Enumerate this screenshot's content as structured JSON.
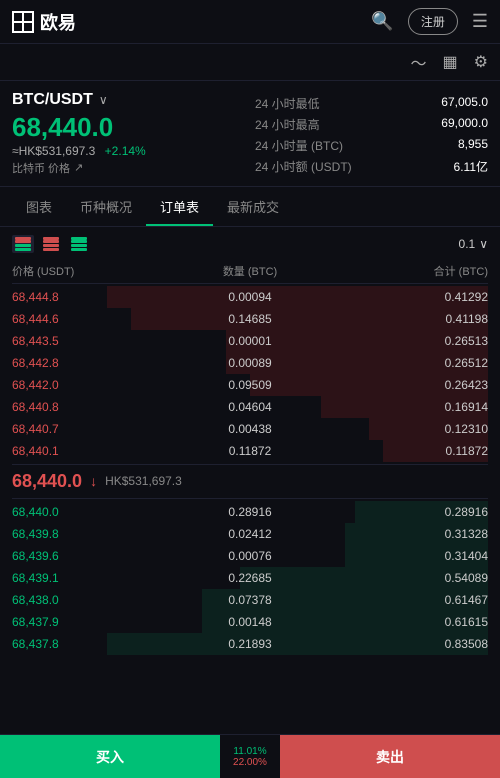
{
  "header": {
    "logo_text": "欧易",
    "register_label": "注册",
    "menu_icon": "☰"
  },
  "subheader": {
    "chart_icon": "📈",
    "list_icon": "📋",
    "settings_icon": "⚙"
  },
  "market": {
    "pair": "BTC/USDT",
    "price": "68,440.0",
    "hkd_approx": "≈HK$531,697.3",
    "change": "+2.14%",
    "coin_label": "比特币 价格",
    "stat1_label": "24 小时最低",
    "stat1_value": "67,005.0",
    "stat2_label": "24 小时最高",
    "stat2_value": "69,000.0",
    "stat3_label": "24 小时量 (BTC)",
    "stat3_value": "8,955",
    "stat4_label": "24 小时额 (USDT)",
    "stat4_value": "6.11亿"
  },
  "tabs": [
    {
      "label": "图表",
      "active": false
    },
    {
      "label": "币种概况",
      "active": false
    },
    {
      "label": "订单表",
      "active": true
    },
    {
      "label": "最新成交",
      "active": false
    }
  ],
  "orderbook": {
    "precision": "0.1",
    "col_price": "价格 (USDT)",
    "col_qty": "数量 (BTC)",
    "col_total": "合计 (BTC)",
    "sell_orders": [
      {
        "price": "68,444.8",
        "qty": "0.00094",
        "total": "0.41292",
        "bar_pct": 80
      },
      {
        "price": "68,444.6",
        "qty": "0.14685",
        "total": "0.41198",
        "bar_pct": 75
      },
      {
        "price": "68,443.5",
        "qty": "0.00001",
        "total": "0.26513",
        "bar_pct": 55
      },
      {
        "price": "68,442.8",
        "qty": "0.00089",
        "total": "0.26512",
        "bar_pct": 55
      },
      {
        "price": "68,442.0",
        "qty": "0.09509",
        "total": "0.26423",
        "bar_pct": 50
      },
      {
        "price": "68,440.8",
        "qty": "0.04604",
        "total": "0.16914",
        "bar_pct": 35
      },
      {
        "price": "68,440.7",
        "qty": "0.00438",
        "total": "0.12310",
        "bar_pct": 25
      },
      {
        "price": "68,440.1",
        "qty": "0.11872",
        "total": "0.11872",
        "bar_pct": 22
      }
    ],
    "mid_price": "68,440.0",
    "mid_hkd": "HK$531,697.3",
    "buy_orders": [
      {
        "price": "68,440.0",
        "qty": "0.28916",
        "total": "0.28916",
        "bar_pct": 28
      },
      {
        "price": "68,439.8",
        "qty": "0.02412",
        "total": "0.31328",
        "bar_pct": 30
      },
      {
        "price": "68,439.6",
        "qty": "0.00076",
        "total": "0.31404",
        "bar_pct": 30
      },
      {
        "price": "68,439.1",
        "qty": "0.22685",
        "total": "0.54089",
        "bar_pct": 52
      },
      {
        "price": "68,438.0",
        "qty": "0.07378",
        "total": "0.61467",
        "bar_pct": 60
      },
      {
        "price": "68,437.9",
        "qty": "0.00148",
        "total": "0.61615",
        "bar_pct": 60
      },
      {
        "price": "68,437.8",
        "qty": "0.21893",
        "total": "0.83508",
        "bar_pct": 80
      }
    ]
  },
  "bottom": {
    "buy_label": "买入",
    "sell_label": "卖出",
    "buy_pct": "11.01%",
    "sell_pct": "22.00%"
  }
}
